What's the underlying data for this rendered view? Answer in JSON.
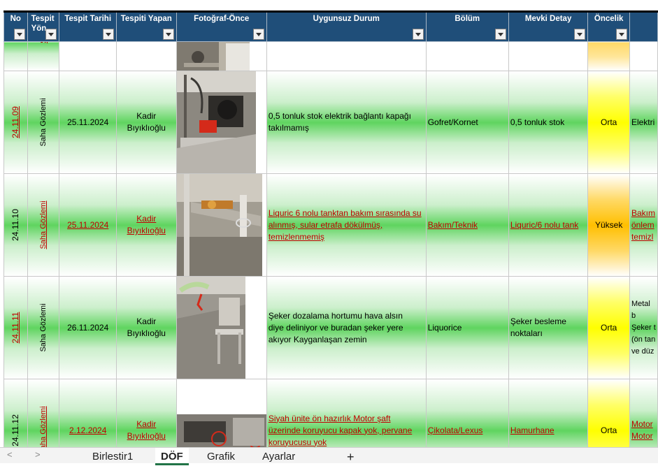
{
  "headers": [
    "No",
    "Tespit Yön",
    "Tespit Tarihi",
    "Tespiti Yapan",
    "Fotoğraf-Önce",
    "Uygunsuz Durum",
    "Bölüm",
    "Mevki Detay",
    "Öncelik",
    ""
  ],
  "partial_row": {
    "no": "",
    "yontem": "S"
  },
  "rows": [
    {
      "no": "24.11.09",
      "yontem": "Saha Gözlemi",
      "tarih": "25.11.2024",
      "yapan": "Kadir Bıyıklıoğlu",
      "durum": "0,5 tonluk stok elektrik bağlantı kapağı takılmamış",
      "bolum": "Gofret/Kornet",
      "mevki": "0,5 tonluk stok",
      "oncelik": "Orta",
      "next": "Elektri"
    },
    {
      "no": "24.11.10",
      "yontem": "Saha Gözlemi",
      "tarih": "25.11.2024",
      "yapan": "Kadir Bıyıklıoğlu",
      "durum": "Liquric 6 nolu tanktan bakım sırasında su alınmış, sular etrafa dökülmüş, temizlenmemiş",
      "bolum": "Bakım/Teknik",
      "mevki": "Liquric/6 nolu tank",
      "oncelik": "Yüksek",
      "next": "Bakım önlem temizl"
    },
    {
      "no": "24.11.11",
      "yontem": "Saha Gözlemi",
      "tarih": "26.11.2024",
      "yapan": "Kadir Bıyıklıoğlu",
      "durum": "Şeker dozalama hortumu hava alsın diye deliniyor ve buradan şeker yere akıyor Kayganlaşan zemin",
      "bolum": "Liquorice",
      "mevki": "Şeker besleme noktaları",
      "oncelik": "Orta",
      "next": "Metal b Şeker t (ön tan ve düz"
    },
    {
      "no": "24.11.12",
      "yontem": "Saha Gözlemi",
      "tarih": "2.12.2024",
      "yapan": "Kadir Bıyıklıoğlu",
      "durum": "Siyah ünite ön hazırlık Motor şaft üzerinde koruyucu kapak yok, pervane koruyucusu yok",
      "bolum": "Çikolata/Lexus",
      "mevki": "Hamurhane",
      "oncelik": "Orta",
      "next": "Motor Motor"
    }
  ],
  "sheet_tabs": [
    "Birlestir1",
    "DÖF",
    "Grafik",
    "Ayarlar",
    "+"
  ],
  "active_tab": "DÖF",
  "nav": [
    "<",
    ">"
  ],
  "colors": {
    "header_bg": "#1f4e79",
    "red_link": "#c00000",
    "green": "#5fd45f",
    "yellow": "#ffff00",
    "orange": "#ffbf00"
  }
}
